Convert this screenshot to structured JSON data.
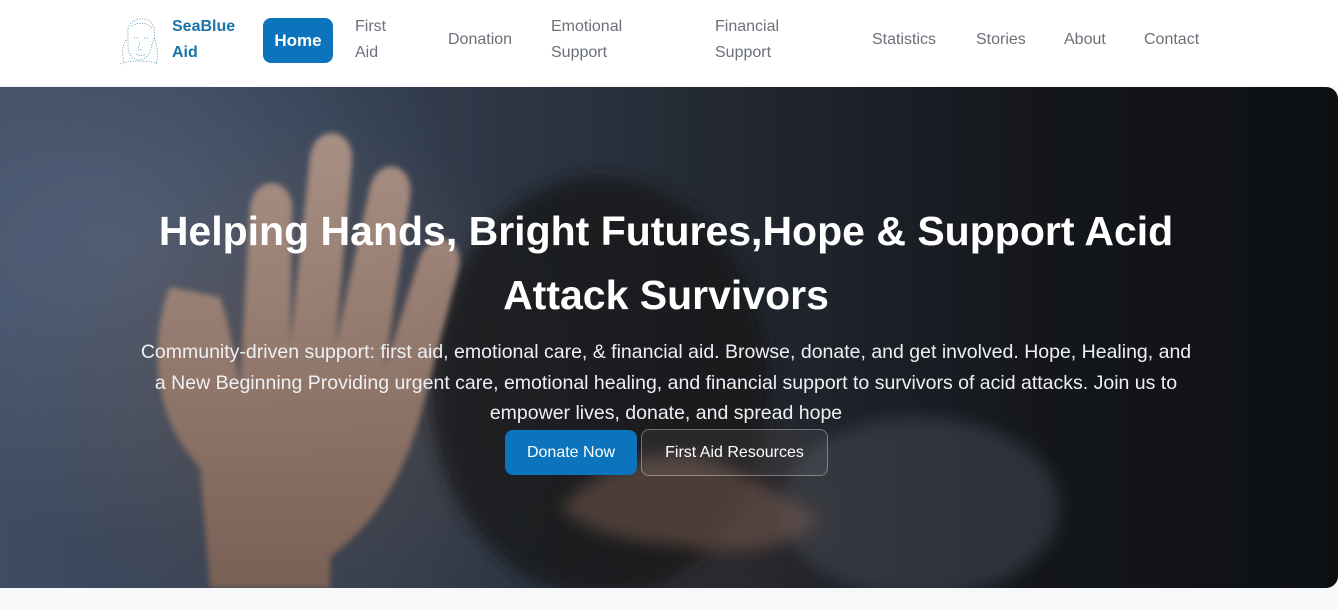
{
  "brand": {
    "name": "SeaBlue Aid",
    "logo_icon": "sketch-face-logo-icon"
  },
  "nav": {
    "home": "Home",
    "first_aid": "First Aid",
    "donation": "Donation",
    "emotional_support": "Emotional Support",
    "financial_support": "Financial Support",
    "statistics": "Statistics",
    "stories": "Stories",
    "about": "About",
    "contact": "Contact",
    "active": "Home"
  },
  "hero": {
    "title": "Helping Hands, Bright Futures,Hope & Support Acid Attack Survivors",
    "subtitle": "Community-driven support: first aid, emotional care, & financial aid. Browse, donate, and get involved. Hope, Healing, and a New Beginning Providing urgent care, emotional healing, and financial support to survivors of acid attacks. Join us to empower lives, donate, and spread hope",
    "donate_button": "Donate Now",
    "resources_button": "First Aid Resources"
  },
  "colors": {
    "brand": "#1a73a8",
    "primary": "#0b74bd",
    "nav_text": "#6b7079"
  }
}
